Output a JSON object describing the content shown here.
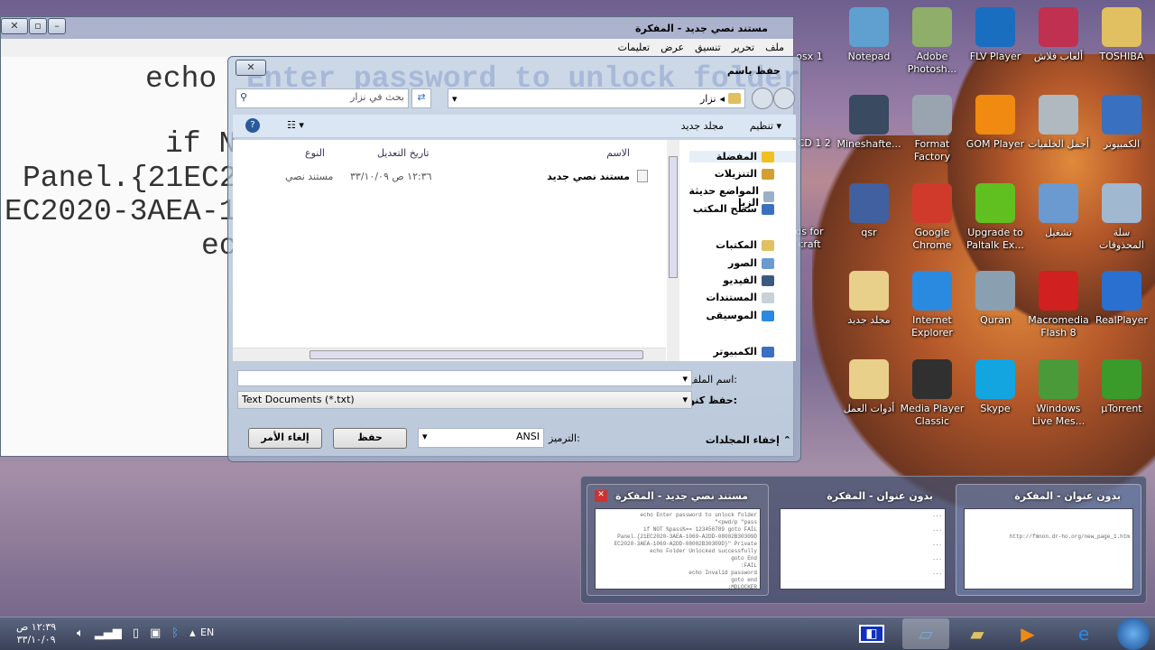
{
  "desktop": {
    "icons": [
      {
        "label": "Notepad",
        "icon": "notepad-icon",
        "color": "#5fa0d0"
      },
      {
        "label": "Adobe Photosh...",
        "icon": "photoshop-icon",
        "color": "#8fae6a"
      },
      {
        "label": "FLV Player",
        "icon": "flv-player-icon",
        "color": "#1a6ec0"
      },
      {
        "label": "ألعاب فلاش",
        "icon": "games-icon",
        "color": "#c03050"
      },
      {
        "label": "TOSHIBA",
        "icon": "folder-user-icon",
        "color": "#e0c060"
      },
      {
        "label": "Mineshafte...",
        "icon": "cube-icon",
        "color": "#3a4a60"
      },
      {
        "label": "Format Factory",
        "icon": "format-factory-icon",
        "color": "#9aa4b0"
      },
      {
        "label": "GOM Player",
        "icon": "gom-player-icon",
        "color": "#f08a10"
      },
      {
        "label": "أجمل الخلفيات",
        "icon": "camera-icon",
        "color": "#b0b8c0"
      },
      {
        "label": "الكمبيوتر",
        "icon": "computer-icon",
        "color": "#3a70c0"
      },
      {
        "label": "qsr",
        "icon": "installer-icon",
        "color": "#4060a0"
      },
      {
        "label": "Google Chrome",
        "icon": "chrome-icon",
        "color": "#d03a2a"
      },
      {
        "label": "Upgrade to Paltalk Ex...",
        "icon": "paltalk-icon",
        "color": "#60c020"
      },
      {
        "label": "تشغيل",
        "icon": "run-icon",
        "color": "#6a9ad0"
      },
      {
        "label": "سلة المحذوفات",
        "icon": "recycle-bin-icon",
        "color": "#a0b8d0"
      },
      {
        "label": "مجلد جديد",
        "icon": "folder-icon",
        "color": "#e8d08a"
      },
      {
        "label": "Internet Explorer",
        "icon": "ie-icon",
        "color": "#2a8ae0"
      },
      {
        "label": "Quran",
        "icon": "quran-icon",
        "color": "#8aa0b0"
      },
      {
        "label": "Macromedia Flash 8",
        "icon": "flash-icon",
        "color": "#d02020"
      },
      {
        "label": "RealPlayer",
        "icon": "realplayer-icon",
        "color": "#2a70d0"
      },
      {
        "label": "أدوات العمل",
        "icon": "folder-icon",
        "color": "#e8d08a"
      },
      {
        "label": "Media Player Classic",
        "icon": "mpc-icon",
        "color": "#303030"
      },
      {
        "label": "Skype",
        "icon": "skype-icon",
        "color": "#12a5e0"
      },
      {
        "label": "Windows Live Mes...",
        "icon": "messenger-icon",
        "color": "#4a9a3a"
      },
      {
        "label": "µTorrent",
        "icon": "utorrent-icon",
        "color": "#3a9a2a"
      }
    ],
    "partial_icons": [
      "osx 1",
      "2 CD 1 2",
      "ds for craft"
    ]
  },
  "notepad": {
    "title": "مستند نصي جديد - المفكرة",
    "menu": [
      "ملف",
      "تحرير",
      "تنسيق",
      "عرض",
      "تعليمات"
    ],
    "lines": [
      "echo",
      "if N",
      "Panel.{21EC2",
      "EC2020-3AEA-1",
      "ec"
    ],
    "ghost": "Enter password to unlock folder"
  },
  "dialog": {
    "title": "حفظ باسم",
    "address": "نزار",
    "search_placeholder": "بحث في نزار",
    "organize": "تنظيم",
    "new_folder": "مجلد جديد",
    "nav": [
      {
        "label": "المفضلة",
        "color": "#f0c020"
      },
      {
        "label": "التنزيلات",
        "color": "#d0a030"
      },
      {
        "label": "المواضع حديثة الزيا",
        "color": "#9ab0c8"
      },
      {
        "label": "سطح المكتب",
        "color": "#3a70c0"
      },
      {
        "label": "المكتبات",
        "color": "#e0c060"
      },
      {
        "label": "الصور",
        "color": "#6a9ad0"
      },
      {
        "label": "الفيديو",
        "color": "#3a5a80"
      },
      {
        "label": "المستندات",
        "color": "#c8d0d8"
      },
      {
        "label": "الموسيقى",
        "color": "#2a8ae0"
      },
      {
        "label": "الكمبيوتر",
        "color": "#3a70c0"
      }
    ],
    "columns": [
      "الاسم",
      "تاريخ التعديل",
      "النوع"
    ],
    "files": [
      {
        "name": "مستند نصي جديد",
        "modified": "١٢:٣٦ ص ٣٣/١٠/٠٩",
        "type": "مستند نصي"
      }
    ],
    "filename_label": "اسم الملف:",
    "filename_value": "",
    "savetype_label": "حفظ كنوع:",
    "savetype_value": "Text Documents (*.txt)",
    "hide_folders": "إخفاء المجلدات",
    "encoding_label": "الترميز:",
    "encoding_value": "ANSI",
    "save": "حفظ",
    "cancel": "إلغاء الأمر"
  },
  "thumbnails": [
    {
      "title": "مستند نصي جديد - المفكرة",
      "preview": "echo Enter password to unlock folder\n\"<pwd/p \"pass\nif NOT %pass%== 123456789 goto FAIL\nPanel.{21EC2020-3AEA-1069-A2DD-08002B30309D\nEC2020-3AEA-1069-A2DD-08002B30309D}\" Private\necho Folder Unlocked successfully\ngoto End\n:FAIL\necho Invalid password\ngoto end\n:MDLOCKER"
    },
    {
      "title": "بدون عنوان - المفكرة",
      "preview": "...\n\n...\n\n...\n\n...\n\n..."
    },
    {
      "title": "بدون عنوان - المفكرة",
      "preview": "\n\n\nhttp://fmnon.dr-ho.org/new_page_1.htm"
    }
  ],
  "tray": {
    "time": "١٢:٣٩ ص",
    "date": "٣٣/١٠/٠٩",
    "language": "EN"
  },
  "taskbar": [
    {
      "icon": "windows-start-icon"
    },
    {
      "icon": "ie-icon"
    },
    {
      "icon": "media-player-icon"
    },
    {
      "icon": "explorer-icon"
    },
    {
      "icon": "notepad-icon"
    },
    {
      "icon": "app-icon"
    }
  ],
  "colors": {
    "selection": "#3399ff",
    "toolbar": "#dbe6f4"
  }
}
